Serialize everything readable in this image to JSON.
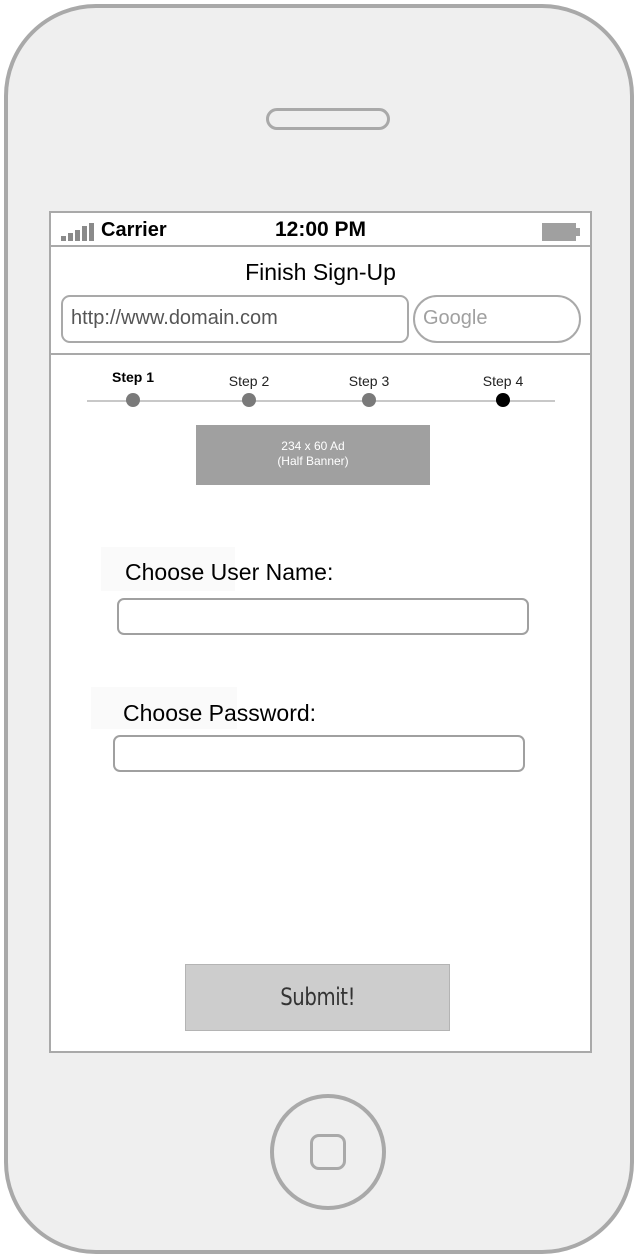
{
  "status_bar": {
    "carrier": "Carrier",
    "time": "12:00 PM",
    "signal_icon": "signal-bars-icon",
    "battery_icon": "battery-icon"
  },
  "header": {
    "title": "Finish Sign-Up",
    "url_value": "http://www.domain.com",
    "search_placeholder": "Google"
  },
  "steps": [
    {
      "label": "Step 1",
      "active": true
    },
    {
      "label": "Step 2",
      "active": false
    },
    {
      "label": "Step 3",
      "active": false
    },
    {
      "label": "Step 4",
      "active": false
    }
  ],
  "ad": {
    "line1": "234 x 60 Ad",
    "line2": "(Half Banner)"
  },
  "form": {
    "username_label": "Choose User Name:",
    "username_value": "",
    "password_label": "Choose Password:",
    "password_value": "",
    "submit_label": "Submit!"
  },
  "colors": {
    "frame": "#a9a9a9",
    "phone_body": "#efefef",
    "ad_background": "#a0a0a0",
    "button_background": "#cdcdcd"
  }
}
